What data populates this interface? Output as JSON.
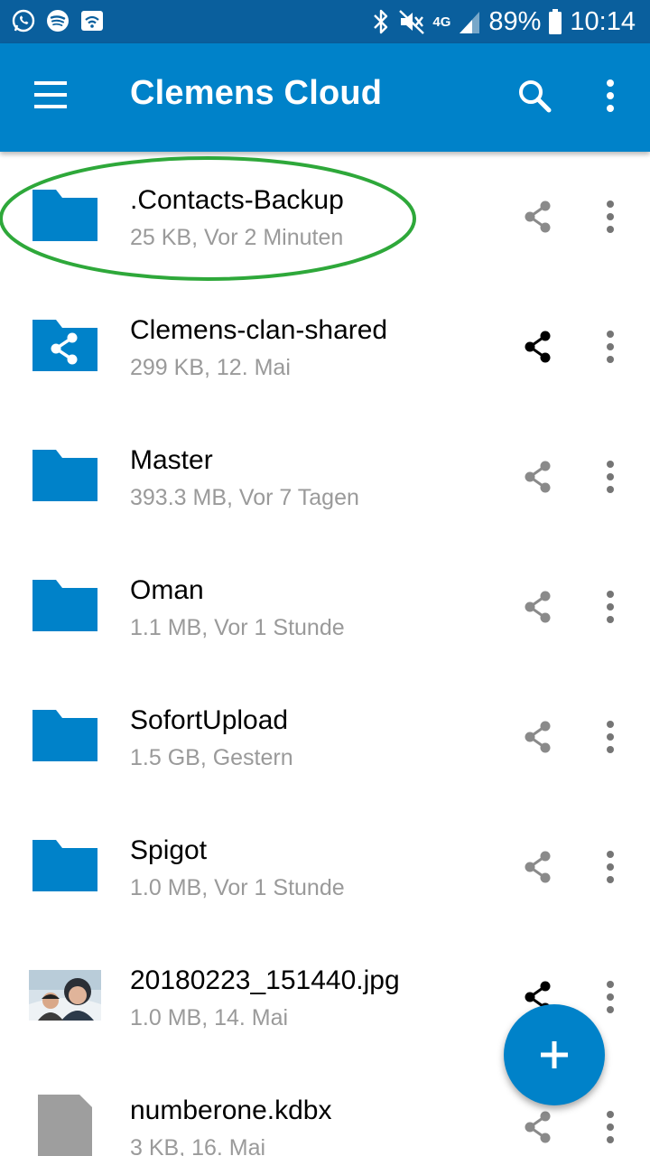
{
  "status_bar": {
    "battery": "89%",
    "time": "10:14",
    "network": "4G",
    "left_icons": [
      "whatsapp-icon",
      "spotify-icon",
      "wifi-icon"
    ],
    "right_icons": [
      "bluetooth-icon",
      "mute-icon",
      "signal-icon",
      "battery-icon"
    ]
  },
  "app_bar": {
    "title": "Clemens Cloud",
    "menu_icon": "menu-icon",
    "search_icon": "search-icon",
    "overflow_icon": "more-vert-icon"
  },
  "files": [
    {
      "name": ".Contacts-Backup",
      "meta": "25 KB, Vor 2 Minuten",
      "type": "folder",
      "shared": false
    },
    {
      "name": "Clemens-clan-shared",
      "meta": "299 KB, 12. Mai",
      "type": "shared-folder",
      "shared": true
    },
    {
      "name": "Master",
      "meta": "393.3 MB, Vor 7 Tagen",
      "type": "folder",
      "shared": false
    },
    {
      "name": "Oman",
      "meta": "1.1 MB, Vor 1 Stunde",
      "type": "folder",
      "shared": false
    },
    {
      "name": "SofortUpload",
      "meta": "1.5 GB, Gestern",
      "type": "folder",
      "shared": false
    },
    {
      "name": "Spigot",
      "meta": "1.0 MB, Vor 1 Stunde",
      "type": "folder",
      "shared": false
    },
    {
      "name": "20180223_151440.jpg",
      "meta": "1.0 MB, 14. Mai",
      "type": "image",
      "shared": true
    },
    {
      "name": "numberone.kdbx",
      "meta": "3 KB, 16. Mai",
      "type": "file",
      "shared": false
    }
  ],
  "colors": {
    "status_bar": "#0a5f9d",
    "app_bar": "#0082c9",
    "folder": "#0082c9",
    "highlight_ellipse": "#2ea83a",
    "meta_text": "#9a9a9a"
  },
  "fab": {
    "icon": "plus-icon"
  }
}
